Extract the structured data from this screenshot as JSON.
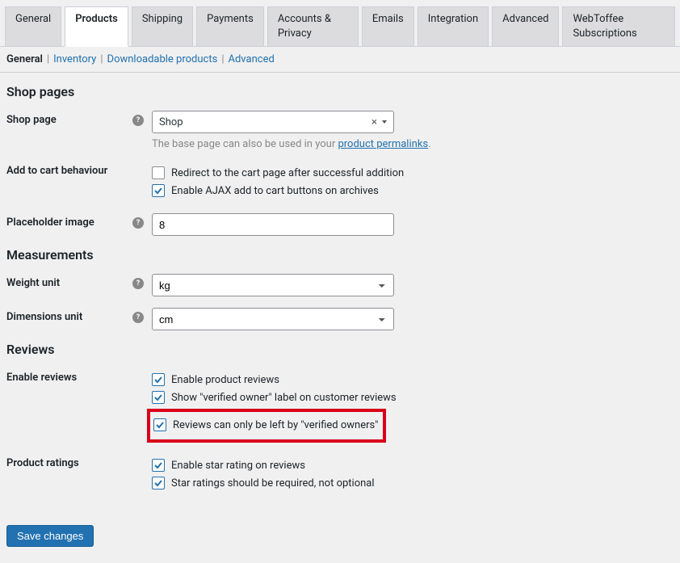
{
  "tabs": [
    {
      "label": "General"
    },
    {
      "label": "Products"
    },
    {
      "label": "Shipping"
    },
    {
      "label": "Payments"
    },
    {
      "label": "Accounts & Privacy"
    },
    {
      "label": "Emails"
    },
    {
      "label": "Integration"
    },
    {
      "label": "Advanced"
    },
    {
      "label": "WebToffee Subscriptions"
    }
  ],
  "active_tab": 1,
  "subtabs": [
    {
      "label": "General"
    },
    {
      "label": "Inventory"
    },
    {
      "label": "Downloadable products"
    },
    {
      "label": "Advanced"
    }
  ],
  "active_subtab": 0,
  "sections": {
    "shop_pages": "Shop pages",
    "measurements": "Measurements",
    "reviews": "Reviews"
  },
  "shop_page": {
    "label": "Shop page",
    "value": "Shop",
    "hint_prefix": "The base page can also be used in your ",
    "hint_link": "product permalinks",
    "hint_suffix": "."
  },
  "add_to_cart": {
    "label": "Add to cart behaviour",
    "redirect": {
      "checked": false,
      "label": "Redirect to the cart page after successful addition"
    },
    "ajax": {
      "checked": true,
      "label": "Enable AJAX add to cart buttons on archives"
    }
  },
  "placeholder": {
    "label": "Placeholder image",
    "value": "8"
  },
  "weight": {
    "label": "Weight unit",
    "value": "kg"
  },
  "dimensions": {
    "label": "Dimensions unit",
    "value": "cm"
  },
  "enable_reviews": {
    "label": "Enable reviews",
    "opt1": {
      "checked": true,
      "label": "Enable product reviews"
    },
    "opt2": {
      "checked": true,
      "label": "Show \"verified owner\" label on customer reviews"
    },
    "opt3": {
      "checked": true,
      "label": "Reviews can only be left by \"verified owners\""
    }
  },
  "ratings": {
    "label": "Product ratings",
    "opt1": {
      "checked": true,
      "label": "Enable star rating on reviews"
    },
    "opt2": {
      "checked": true,
      "label": "Star ratings should be required, not optional"
    }
  },
  "save_label": "Save changes"
}
